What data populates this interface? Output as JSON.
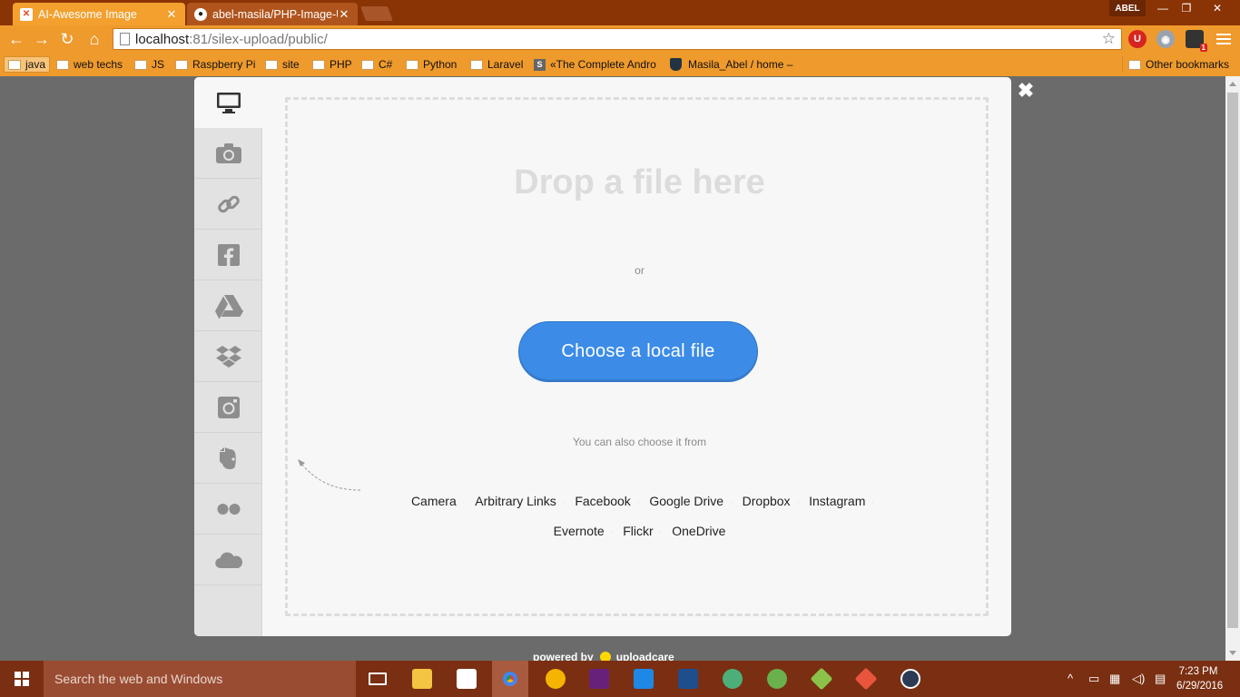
{
  "browser": {
    "tabs": [
      {
        "label": "AI-Awesome Image",
        "active": true,
        "favicon": "xampp-icon"
      },
      {
        "label": "abel-masila/PHP-Image-U",
        "active": false,
        "favicon": "github-icon"
      }
    ],
    "profile_name": "ABEL",
    "window_controls": {
      "minimize": "—",
      "restore": "❐",
      "close": "✕"
    },
    "url_host": "localhost",
    "url_rest": ":81/silex-upload/public/",
    "bookmarks": [
      {
        "label": "java",
        "type": "folder"
      },
      {
        "label": "web techs",
        "type": "folder"
      },
      {
        "label": "JS",
        "type": "folder"
      },
      {
        "label": "Raspberry Pi",
        "type": "folder"
      },
      {
        "label": "site",
        "type": "folder"
      },
      {
        "label": "PHP",
        "type": "folder"
      },
      {
        "label": "C#",
        "type": "folder"
      },
      {
        "label": "Python",
        "type": "folder"
      },
      {
        "label": "Laravel",
        "type": "folder"
      },
      {
        "label": "«The Complete Andro",
        "type": "page"
      },
      {
        "label": "Masila_Abel / home –",
        "type": "page"
      }
    ],
    "other_bookmarks": "Other bookmarks",
    "extension_badge": "1"
  },
  "uploader": {
    "drop_title": "Drop a file here",
    "or_text": "or",
    "choose_button": "Choose a local file",
    "also_text": "You can also choose it from",
    "sources_line1": [
      "Camera",
      "Arbitrary Links",
      "Facebook",
      "Google Drive",
      "Dropbox",
      "Instagram"
    ],
    "sources_line2": [
      "Evernote",
      "Flickr",
      "OneDrive"
    ],
    "tabs": [
      "computer-icon",
      "camera-icon",
      "link-icon",
      "facebook-icon",
      "google-drive-icon",
      "dropbox-icon",
      "instagram-icon",
      "evernote-icon",
      "flickr-icon",
      "onedrive-icon"
    ],
    "close_symbol": "✖",
    "powered_by": "powered by",
    "brand": "uploadcare",
    "button_color": "#3c8ce7"
  },
  "taskbar": {
    "search_placeholder": "Search the web and Windows",
    "time": "7:23 PM",
    "date": "6/29/2016"
  }
}
